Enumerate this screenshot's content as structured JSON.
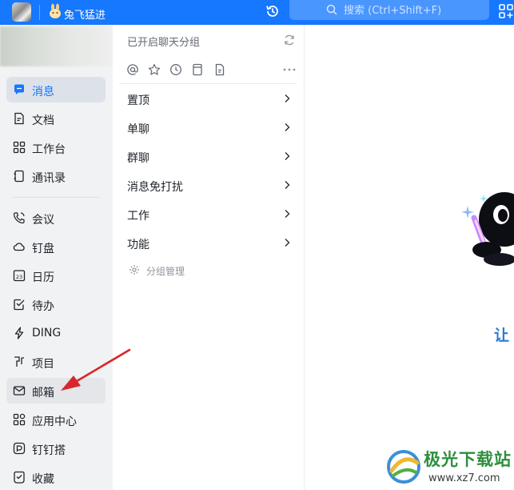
{
  "topbar": {
    "org_name": "兔飞猛进",
    "search_placeholder": "搜索 (Ctrl+Shift+F)",
    "accent": "#1677ff"
  },
  "sidebar": {
    "items": [
      {
        "label": "消息",
        "icon": "chat-bubble-icon",
        "state": "selected"
      },
      {
        "label": "文档",
        "icon": "document-icon"
      },
      {
        "label": "工作台",
        "icon": "apps-grid-icon"
      },
      {
        "label": "通讯录",
        "icon": "contacts-icon"
      },
      {
        "label": "会议",
        "icon": "phone-icon"
      },
      {
        "label": "钉盘",
        "icon": "cloud-icon"
      },
      {
        "label": "日历",
        "icon": "calendar-icon",
        "badge": "23"
      },
      {
        "label": "待办",
        "icon": "todo-check-icon"
      },
      {
        "label": "DING",
        "icon": "ding-bolt-icon"
      },
      {
        "label": "项目",
        "icon": "project-icon"
      },
      {
        "label": "邮箱",
        "icon": "mail-icon",
        "state": "highlighted"
      },
      {
        "label": "应用中心",
        "icon": "app-center-icon"
      },
      {
        "label": "钉钉搭",
        "icon": "dingda-icon"
      },
      {
        "label": "收藏",
        "icon": "favorites-icon"
      }
    ]
  },
  "middle": {
    "title": "已开启聊天分组",
    "toolbar_icons": [
      "at-icon",
      "star-icon",
      "clock-icon",
      "bookmark-icon",
      "file-icon",
      "more-icon"
    ],
    "groups": [
      {
        "label": "置顶"
      },
      {
        "label": "单聊"
      },
      {
        "label": "群聊"
      },
      {
        "label": "消息免打扰"
      },
      {
        "label": "工作"
      },
      {
        "label": "功能"
      }
    ],
    "manage_label": "分组管理"
  },
  "main": {
    "welcome_partial": "让",
    "welcome_color": "#2a7ad5"
  },
  "watermark": {
    "text": "极光下载站",
    "url": "www.xz7.com"
  },
  "annotation": {
    "arrow_color": "#d9262c"
  }
}
